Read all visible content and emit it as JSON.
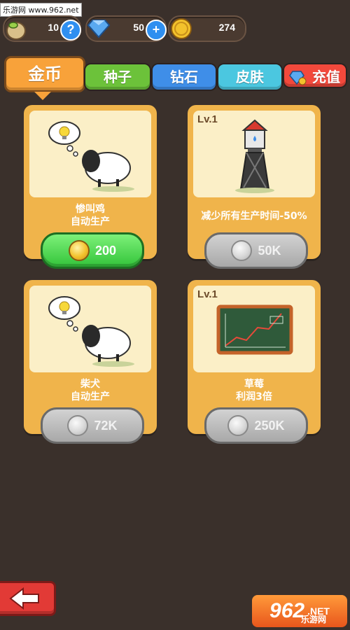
{
  "watermark": "乐游网 www.962.net",
  "resources": {
    "seeds": "10",
    "diamonds": "50",
    "coins": "274"
  },
  "tabs": [
    {
      "label": "金币",
      "color": "#f8a23a",
      "active": true
    },
    {
      "label": "种子",
      "color": "#6cc23a",
      "active": false
    },
    {
      "label": "钻石",
      "color": "#3f8ee8",
      "active": false
    },
    {
      "label": "皮肤",
      "color": "#4bc7e0",
      "active": false
    },
    {
      "label": "充值",
      "color": "#f2493c",
      "active": false
    }
  ],
  "cards": [
    {
      "level": "",
      "line1": "惨叫鸡",
      "line2": "自动生产",
      "price": "200",
      "button_state": "green",
      "image": "sheep-with-lightbulb"
    },
    {
      "level": "Lv.1",
      "line1": "减少所有生产时间-50%",
      "line2": "",
      "price": "50K",
      "button_state": "grey",
      "image": "water-tower"
    },
    {
      "level": "",
      "line1": "柴犬",
      "line2": "自动生产",
      "price": "72K",
      "button_state": "grey",
      "image": "sheep-with-lightbulb"
    },
    {
      "level": "Lv.1",
      "line1": "草莓",
      "line2": "利润3倍",
      "price": "250K",
      "button_state": "grey",
      "image": "chalkboard-chart"
    }
  ],
  "logo": {
    "main": "962",
    "suffix": ".NET",
    "sub": "乐游网"
  }
}
